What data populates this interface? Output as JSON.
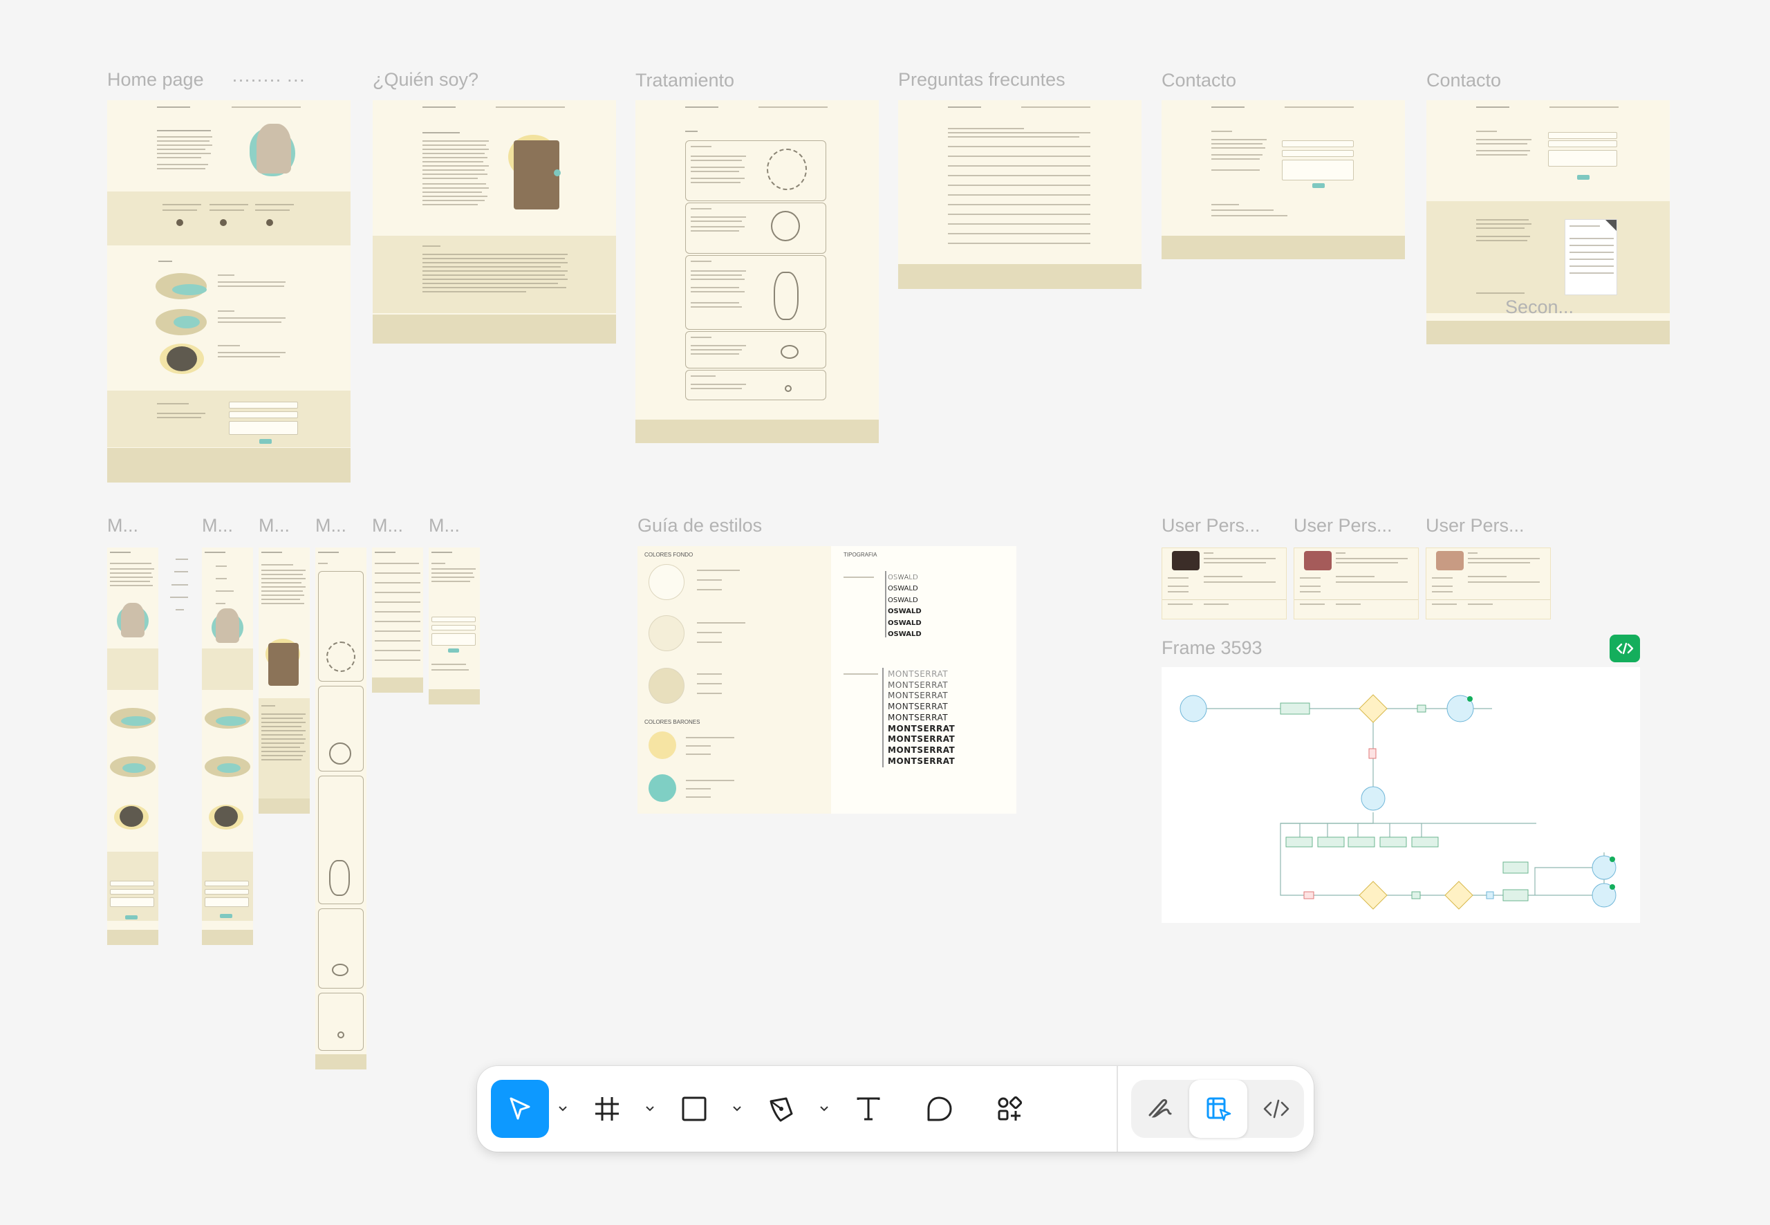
{
  "frames": {
    "home": {
      "label": "Home page",
      "suffix": "········  ···"
    },
    "quien": {
      "label": "¿Quién soy?"
    },
    "tratamiento": {
      "label": "Tratamiento"
    },
    "preguntas": {
      "label": "Preguntas frecuntes"
    },
    "contacto1": {
      "label": "Contacto"
    },
    "contacto2": {
      "label": "Contacto",
      "overlay": "Secon..."
    },
    "mobile": {
      "labels": [
        "M...",
        "M...",
        "M...",
        "M...",
        "M...",
        "M..."
      ]
    },
    "guia": {
      "label": "Guía de estilos",
      "colores_fondo": "COLORES FONDO",
      "colores_ramones": "COLORES BARONES",
      "tipografia": "TIPOGRAFIA",
      "oswald": [
        "OSWALD",
        "OSWALD",
        "OSWALD",
        "OSWALD",
        "OSWALD",
        "OSWALD"
      ],
      "montserrat": [
        "MONTSERRAT",
        "MONTSERRAT",
        "MONTSERRAT",
        "MONTSERRAT",
        "MONTSERRAT",
        "MONTSERRAT",
        "MONTSERRAT",
        "MONTSERRAT",
        "MONTSERRAT"
      ],
      "swatches": [
        {
          "color": "#fdfbf1"
        },
        {
          "color": "#f4eed8"
        },
        {
          "color": "#e8dfbd"
        },
        {
          "color": "#f6e4a3"
        },
        {
          "color": "#7fcfc4"
        }
      ]
    },
    "personas": {
      "labels": [
        "User Pers...",
        "User Pers...",
        "User Pers..."
      ]
    },
    "flow": {
      "label": "Frame 3593"
    }
  },
  "toolbar": {
    "tools": [
      {
        "name": "move-tool",
        "icon": "cursor-icon"
      },
      {
        "name": "frame-tool",
        "icon": "hash-icon"
      },
      {
        "name": "rectangle-tool",
        "icon": "rectangle-icon"
      },
      {
        "name": "pen-tool",
        "icon": "pen-icon"
      },
      {
        "name": "text-tool",
        "icon": "text-icon"
      },
      {
        "name": "comment-tool",
        "icon": "comment-icon"
      },
      {
        "name": "actions-tool",
        "icon": "shapes-plus-icon"
      },
      {
        "name": "draw-mode",
        "icon": "scribble-icon"
      },
      {
        "name": "design-mode",
        "icon": "design-icon"
      },
      {
        "name": "dev-mode",
        "icon": "code-icon"
      }
    ]
  },
  "colors": {
    "accent": "#0d99ff",
    "canvas": "#f5f5f5",
    "frame_bg": "#fbf7e8",
    "teal": "#7ec8c0",
    "dev_green": "#14ae5c"
  }
}
